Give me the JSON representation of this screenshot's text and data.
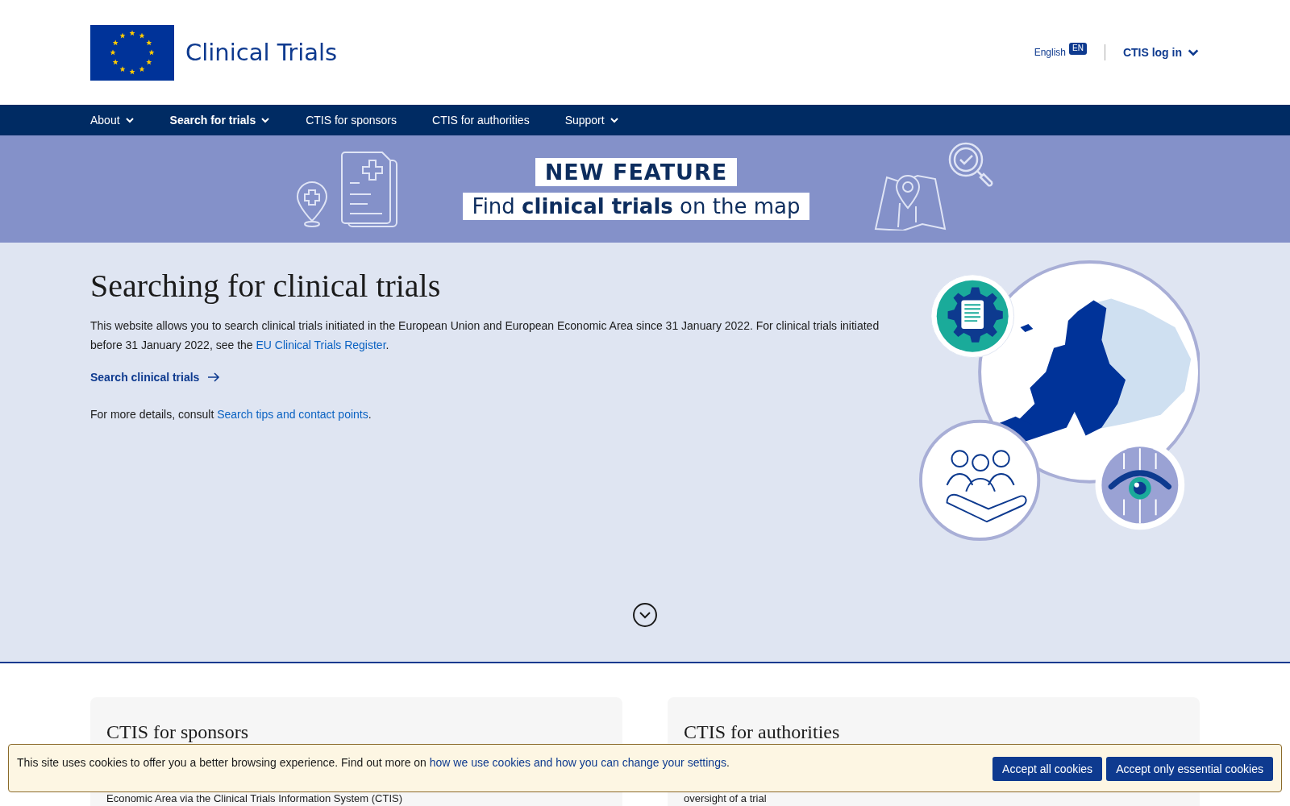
{
  "header": {
    "title": "Clinical Trials",
    "language": {
      "label": "English",
      "code": "EN"
    },
    "login": "CTIS log in"
  },
  "nav": [
    {
      "label": "About",
      "dropdown": true,
      "selected": false
    },
    {
      "label": "Search for trials",
      "dropdown": true,
      "selected": true
    },
    {
      "label": "CTIS for sponsors",
      "dropdown": false,
      "selected": false
    },
    {
      "label": "CTIS for authorities",
      "dropdown": false,
      "selected": false
    },
    {
      "label": "Support",
      "dropdown": true,
      "selected": false
    }
  ],
  "promo": {
    "badge": "NEW FEATURE",
    "headline": "Find **clinical trials** on the map"
  },
  "hero": {
    "title": "Searching for clinical trials",
    "intro": {
      "text_before": "This website allows you to search clinical trials initiated in the European Union and European Economic Area since 31 January 2022. For clinical trials initiated before 31 January 2022, see the ",
      "link": "EU Clinical Trials Register",
      "text_after": "."
    },
    "search_link": "Search clinical trials",
    "details": {
      "text_before": "For more details, consult ",
      "link": "Search tips and contact points",
      "text_after": "."
    }
  },
  "cards": [
    {
      "title": "CTIS for sponsors",
      "text": "Economic Area via the Clinical Trials Information System (CTIS)"
    },
    {
      "title": "CTIS for authorities",
      "text": "oversight of a trial"
    }
  ],
  "cookie_banner": {
    "text_before": "This site uses cookies to offer you a better browsing experience. Find out more on ",
    "link": "how we use cookies and how you can change your settings",
    "text_after": ".",
    "buttons": [
      "Accept all cookies",
      "Accept only essential cookies"
    ]
  }
}
